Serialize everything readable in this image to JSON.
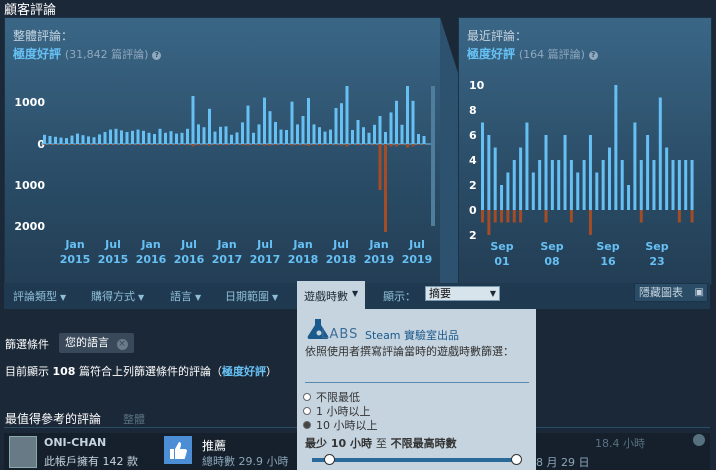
{
  "section_title": "顧客評論",
  "overall": {
    "title": "整體評論：",
    "score": "極度好評",
    "count": "(31,842 篇評論)",
    "help": "?"
  },
  "recent": {
    "title": "最近評論：",
    "score": "極度好評",
    "count": "(164 篇評論)",
    "help": "?"
  },
  "chart_data": [
    {
      "type": "bar",
      "title": "整體評論",
      "yticks": [
        "1000",
        "0",
        "1000",
        "2000"
      ],
      "xticks": [
        [
          "Jan",
          "2015"
        ],
        [
          "Jul",
          "2015"
        ],
        [
          "Jan",
          "2016"
        ],
        [
          "Jul",
          "2016"
        ],
        [
          "Jan",
          "2017"
        ],
        [
          "Jul",
          "2017"
        ],
        [
          "Jan",
          "2018"
        ],
        [
          "Jul",
          "2018"
        ],
        [
          "Jan",
          "2019"
        ],
        [
          "Jul",
          "2019"
        ]
      ],
      "positive": [
        230,
        200,
        180,
        160,
        150,
        210,
        260,
        220,
        190,
        170,
        240,
        300,
        360,
        380,
        340,
        300,
        330,
        360,
        330,
        280,
        250,
        380,
        280,
        320,
        260,
        280,
        380,
        1200,
        490,
        420,
        880,
        310,
        430,
        440,
        230,
        290,
        540,
        960,
        280,
        490,
        1160,
        820,
        550,
        360,
        350,
        1060,
        490,
        700,
        1150,
        490,
        420,
        310,
        360,
        900,
        1020,
        1550,
        350,
        600,
        420,
        280,
        480,
        700,
        300,
        790,
        1080,
        480,
        1450,
        1080,
        250,
        200
      ],
      "negative": [
        20,
        20,
        20,
        20,
        20,
        20,
        20,
        20,
        20,
        20,
        20,
        20,
        20,
        20,
        20,
        20,
        20,
        20,
        20,
        20,
        20,
        20,
        20,
        20,
        20,
        20,
        30,
        60,
        30,
        30,
        40,
        20,
        30,
        30,
        20,
        20,
        30,
        40,
        20,
        30,
        40,
        40,
        30,
        20,
        20,
        40,
        30,
        30,
        50,
        30,
        30,
        20,
        20,
        30,
        40,
        60,
        20,
        30,
        20,
        20,
        30,
        1150,
        2200,
        60,
        60,
        30,
        90,
        60,
        20,
        20
      ],
      "colors": {
        "positive": "#66c0f4",
        "negative": "#a34c25"
      }
    },
    {
      "type": "bar",
      "title": "最近評論",
      "yticks": [
        "10",
        "8",
        "6",
        "4",
        "2",
        "0",
        "2"
      ],
      "xticks": [
        [
          "Sep",
          "01"
        ],
        [
          "Sep",
          "08"
        ],
        [
          "Sep",
          "16"
        ],
        [
          "Sep",
          "23"
        ]
      ],
      "positive": [
        7,
        6,
        5,
        2,
        3,
        4,
        5,
        7,
        3,
        4,
        6,
        4,
        4,
        6,
        4,
        3,
        4,
        6,
        3,
        4,
        5,
        10,
        4,
        2,
        7,
        4,
        6,
        4,
        9,
        5,
        4,
        4,
        4,
        4
      ],
      "negative": [
        1,
        2,
        1,
        1,
        1,
        1,
        1,
        0,
        0,
        0,
        1,
        0,
        0,
        0,
        1,
        0,
        0,
        2,
        0,
        0,
        0,
        0,
        0,
        0,
        0,
        1,
        0,
        0,
        0,
        0,
        0,
        1,
        0,
        1
      ],
      "colors": {
        "positive": "#66c0f4",
        "negative": "#a34c25"
      }
    }
  ],
  "filters": {
    "review_type": "評論類型",
    "purchase": "購得方式",
    "language": "語言",
    "date_range": "日期範圍",
    "playtime": "遊戲時數",
    "display_label": "顯示：",
    "display_value": "摘要",
    "hide_graph": "隱藏圖表"
  },
  "dropdown": {
    "labs": "LABS",
    "steam_labs": "Steam 實驗室出品",
    "desc": "依照使用者撰寫評論當時的遊戲時數篩選：",
    "options": [
      "不限最低",
      "1 小時以上",
      "10 小時以上"
    ],
    "selected_option_index": 2,
    "min_label": "最少 10 小時",
    "to": "至",
    "max_label": "不限最高時數"
  },
  "filter_condition": {
    "label": "篩選條件",
    "chip": "您的語言",
    "chip_close": "×"
  },
  "showing": {
    "prefix": "目前顯示",
    "count": "108",
    "mid": "篇符合上列篩選條件的評論（",
    "score": "極度好評",
    "suffix": "）"
  },
  "helpful": {
    "title": "最值得參考的評論",
    "tab": "整體"
  },
  "review": {
    "user": "ONI-CHAN",
    "products": "此帳戶擁有 142 款",
    "recommend": "推薦",
    "total_playtime": "總時數 29.9 小時",
    "playtime_at_review": "18.4 小時",
    "date": "8 月 29 日"
  }
}
